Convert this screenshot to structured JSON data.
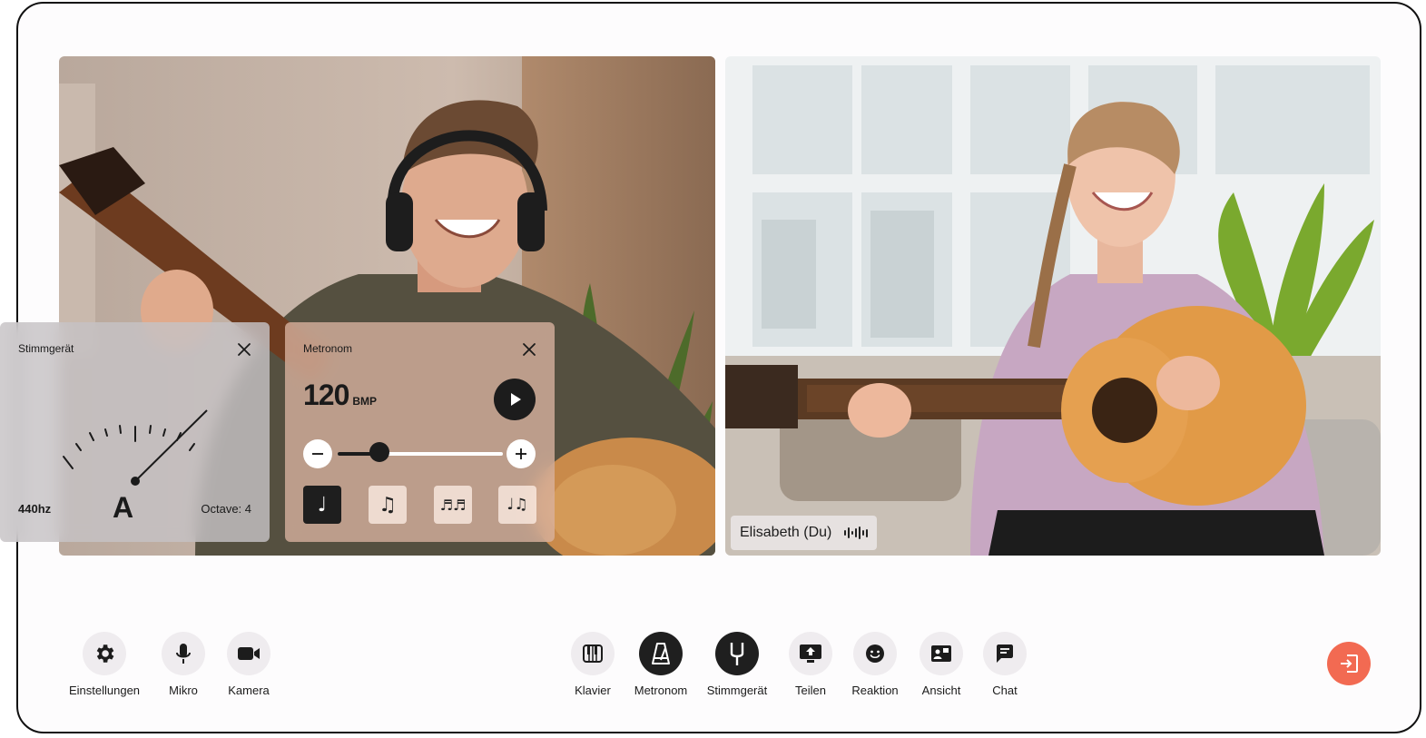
{
  "participants": {
    "self_label": "Elisabeth (Du)"
  },
  "tuner": {
    "title": "Stimmgerät",
    "frequency": "440hz",
    "note": "A",
    "octave": "Octave: 4"
  },
  "metronome": {
    "title": "Metronom",
    "bpm": "120",
    "unit": "BMP",
    "tempo_fraction": 0.25,
    "note_values": [
      "♩",
      "♫",
      "♬♬",
      "♩♫"
    ],
    "active_note_index": 0
  },
  "toolbar": {
    "left": [
      {
        "label": "Einstellungen",
        "icon": "gear-icon"
      },
      {
        "label": "Mikro",
        "icon": "microphone-icon"
      },
      {
        "label": "Kamera",
        "icon": "camera-icon"
      }
    ],
    "center": [
      {
        "label": "Klavier",
        "icon": "piano-icon",
        "active": false
      },
      {
        "label": "Metronom",
        "icon": "metronome-icon",
        "active": true
      },
      {
        "label": "Stimmgerät",
        "icon": "tuning-fork-icon",
        "active": true
      },
      {
        "label": "Teilen",
        "icon": "screen-share-icon",
        "active": false
      },
      {
        "label": "Reaktion",
        "icon": "smiley-icon",
        "active": false
      },
      {
        "label": "Ansicht",
        "icon": "layout-icon",
        "active": false
      },
      {
        "label": "Chat",
        "icon": "chat-icon",
        "active": false
      }
    ],
    "leave_icon": "leave-icon"
  },
  "colors": {
    "leave": "#f26a52",
    "dark": "#1f1f1f",
    "tool_bg": "#efecef"
  }
}
